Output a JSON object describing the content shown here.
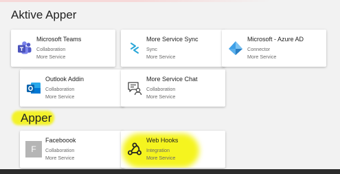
{
  "sections": {
    "active_title": "Aktive Apper",
    "apps_title": "Apper"
  },
  "active_apps": [
    {
      "name": "Microsoft Teams",
      "category": "Collaboration",
      "publisher": "More Service",
      "icon": "teams-icon"
    },
    {
      "name": "More Service Sync",
      "category": "Sync",
      "publisher": "More Service",
      "icon": "sync-icon"
    },
    {
      "name": "Microsoft - Azure AD",
      "category": "Connector",
      "publisher": "More Service",
      "icon": "azure-ad-icon"
    },
    {
      "name": "Outlook Addin",
      "category": "Collaboration",
      "publisher": "More Service",
      "icon": "outlook-icon"
    },
    {
      "name": "More Service Chat",
      "category": "Collaboration",
      "publisher": "More Service",
      "icon": "chat-icon"
    }
  ],
  "apps": [
    {
      "name": "Faceboook",
      "category": "Collaboration",
      "publisher": "More Service",
      "icon": "letter-f-icon",
      "icon_letter": "F"
    },
    {
      "name": "Web Hooks",
      "category": "Integration",
      "publisher": "More Service",
      "icon": "webhooks-icon"
    }
  ],
  "colors": {
    "highlight": "#f3f22a",
    "teams": "#5059c9",
    "outlook": "#0a64ad",
    "azure": "#3ea0e8"
  }
}
